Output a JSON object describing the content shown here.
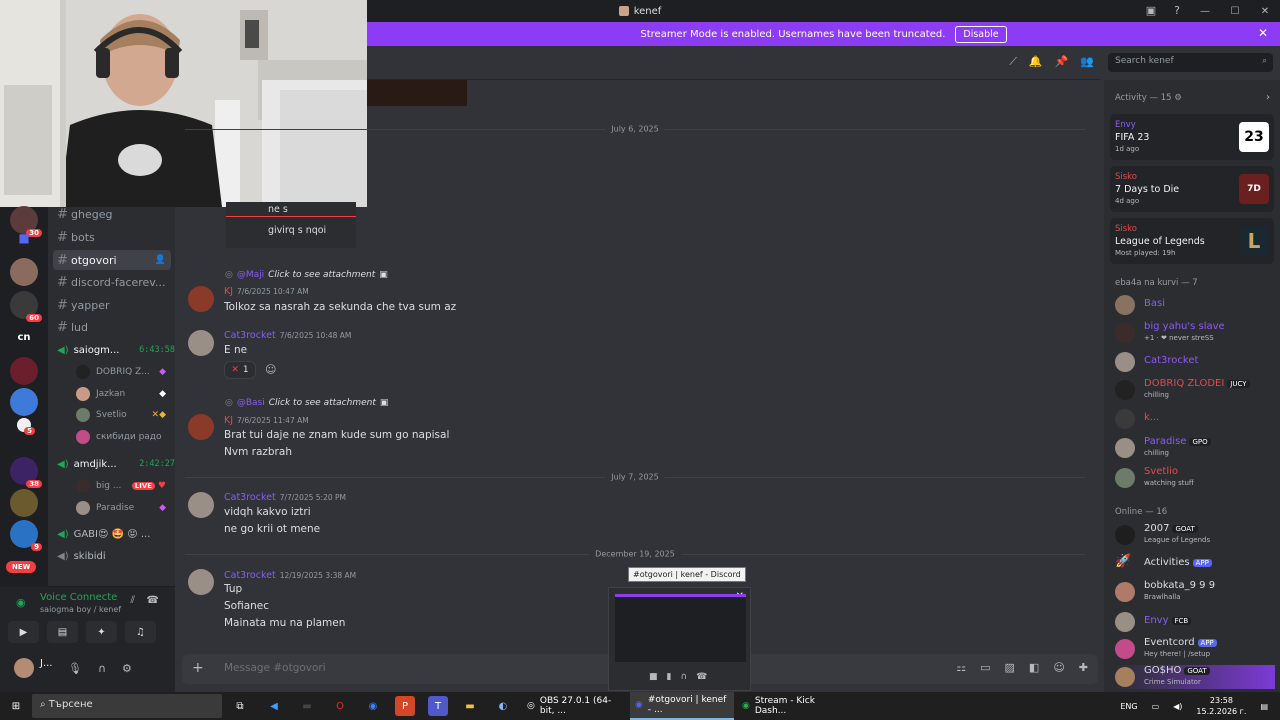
{
  "window": {
    "title": "kenef"
  },
  "banner": {
    "text": "Streamer Mode is enabled. Usernames have been truncated.",
    "button": "Disable"
  },
  "servers": {
    "badges": [
      "30",
      "60",
      "5",
      "38",
      "9"
    ],
    "new_label": "NEW",
    "cn": "cn"
  },
  "channels": {
    "items": [
      {
        "name": "ghegeg"
      },
      {
        "name": "bots"
      },
      {
        "name": "otgovori"
      },
      {
        "name": "discord-facerev..."
      },
      {
        "name": "yapper"
      },
      {
        "name": "lud"
      }
    ],
    "voice1": {
      "name": "saiogm...",
      "time": "6:43:58",
      "users": [
        "DOBRIQ Z...",
        "Jazkan",
        "Svetlio",
        "скибиди радо"
      ]
    },
    "voice2": {
      "name": "amdjik...",
      "time": "2:42:27",
      "users": [
        "big ...",
        "Paradise"
      ],
      "live": "LIVE"
    },
    "more": [
      {
        "name": "GABI😍 🤩 😝 ..."
      },
      {
        "name": "skibidi"
      }
    ]
  },
  "voice_panel": {
    "title": "Voice Connecte",
    "subtitle": "saiogma boy / kenef"
  },
  "user_panel": {
    "name": "J..."
  },
  "search": {
    "placeholder": "Search kenef"
  },
  "chat": {
    "dates": [
      "July 6, 2025",
      "July 7, 2025",
      "December 19, 2025"
    ],
    "table_rows": [
      "ne s",
      "givirq s  nqoi"
    ],
    "messages": [
      {
        "reply_name": "@Maji",
        "reply_text": "Click to see attachment",
        "author": "KJ",
        "time": "7/6/2025 10:47 AM",
        "lines": [
          "Tolkoz sa nasrah za sekunda che tva sum az"
        ]
      },
      {
        "author": "Cat3rocket",
        "time": "7/6/2025 10:48 AM",
        "lines": [
          "E ne"
        ],
        "reaction": "1"
      },
      {
        "reply_name": "@Basi",
        "reply_text": "Click to see attachment",
        "author": "KJ",
        "time": "7/6/2025 11:47 AM",
        "lines": [
          "Brat tui daje ne znam kude sum go napisal",
          "Nvm razbrah"
        ]
      },
      {
        "author": "Cat3rocket",
        "time": "7/7/2025 5:20 PM",
        "lines": [
          "vidqh kakvo iztri",
          "ne go krii ot mene"
        ]
      },
      {
        "author": "Cat3rocket",
        "time": "12/19/2025 3:38 AM",
        "lines": [
          "Tup",
          "Sofianec",
          "Mainata mu na plamen"
        ]
      }
    ]
  },
  "composer": {
    "placeholder": "Message #otgovori"
  },
  "members": {
    "activity_header": "Activity — 15",
    "activities": [
      {
        "name": "Envy",
        "game": "FIFA 23",
        "status": "1d ago",
        "art": "23"
      },
      {
        "name": "Sisko",
        "game": "7 Days to Die",
        "status": "4d ago",
        "art": "7D"
      },
      {
        "name": "Sisko",
        "game": "League of Legends",
        "status": "Most played: 19h",
        "art": "L"
      }
    ],
    "group1_header": "eba4a na kurvi — 7",
    "group1": [
      {
        "name": "Basi",
        "status": "",
        "tag": ""
      },
      {
        "name": "big yahu's slave",
        "status": "+1 · ❤ never streSS",
        "tag": ""
      },
      {
        "name": "Cat3rocket",
        "status": "",
        "tag": ""
      },
      {
        "name": "DOBRIQ ZLODEI",
        "status": "chilling",
        "tag": "JUCY"
      },
      {
        "name": "k...",
        "status": "",
        "tag": ""
      },
      {
        "name": "Paradise",
        "status": "chilling",
        "tag": "GPO"
      },
      {
        "name": "Svetlio",
        "status": "watching stuff",
        "tag": ""
      }
    ],
    "group2_header": "Online — 16",
    "group2": [
      {
        "name": "2007",
        "status": "League of Legends",
        "tag": "GOAT"
      },
      {
        "name": "Activities",
        "status": "",
        "tag": "APP"
      },
      {
        "name": "bobkata_9 9 9",
        "status": "Brawlhalla",
        "tag": ""
      },
      {
        "name": "Envy",
        "status": "",
        "tag": "FCB"
      },
      {
        "name": "Eventcord",
        "status": "Hey there! | /setup",
        "tag": "APP"
      },
      {
        "name": "GO$HO",
        "status": "Crime Simulator",
        "tag": "GOAT"
      }
    ]
  },
  "preview": {
    "tooltip": "#otgovori | kenef - Discord"
  },
  "taskbar": {
    "search": "Търсене",
    "apps": [
      {
        "label": "OBS 27.0.1 (64-bit, ..."
      },
      {
        "label": "#otgovori | kenef - ..."
      },
      {
        "label": "Stream - Kick Dash..."
      }
    ],
    "lang": "ENG",
    "time": "23:58",
    "date": "15.2.2026 г."
  }
}
